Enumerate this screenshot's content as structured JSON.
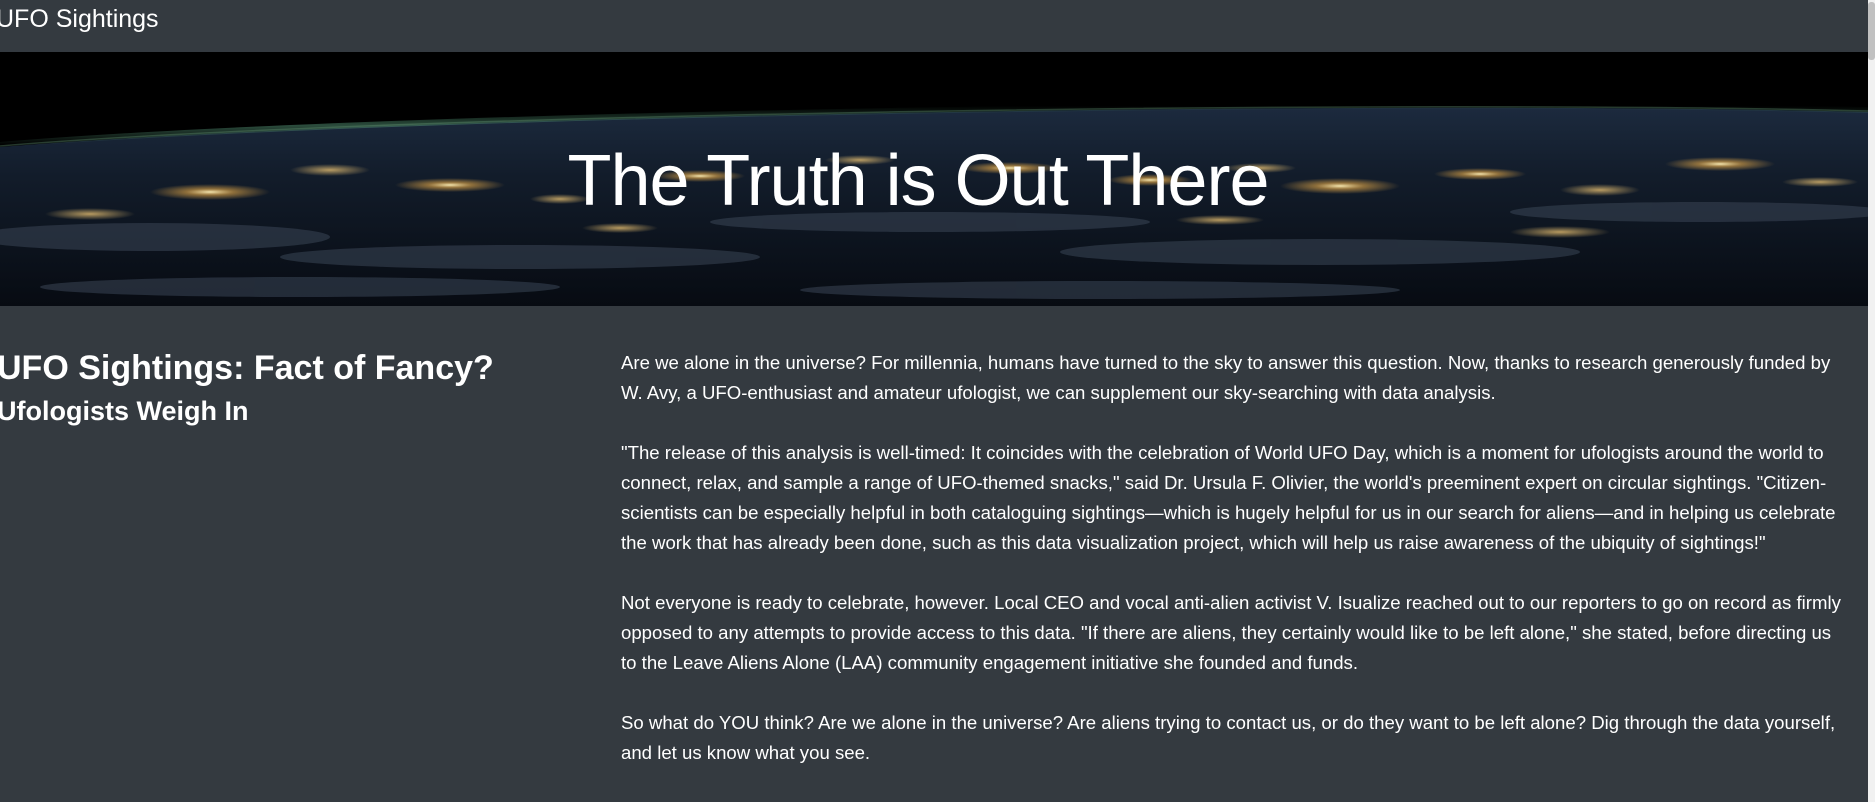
{
  "navbar": {
    "brand": "UFO Sightings"
  },
  "hero": {
    "title": "The Truth is Out There"
  },
  "main": {
    "headline": "UFO Sightings: Fact of Fancy?",
    "subheadline": "Ufologists Weigh In",
    "paragraphs": [
      "Are we alone in the universe? For millennia, humans have turned to the sky to answer this question. Now, thanks to research generously funded by W. Avy, a UFO-enthusiast and amateur ufologist, we can supplement our sky-searching with data analysis.",
      "\"The release of this analysis is well-timed: It coincides with the celebration of World UFO Day, which is a moment for ufologists around the world to connect, relax, and sample a range of UFO-themed snacks,\" said Dr. Ursula F. Olivier, the world's preeminent expert on circular sightings. \"Citizen-scientists can be especially helpful in both cataloguing sightings—which is hugely helpful for us in our search for aliens—and in helping us celebrate the work that has already been done, such as this data visualization project, which will help us raise awareness of the ubiquity of sightings!\"",
      "Not everyone is ready to celebrate, however. Local CEO and vocal anti-alien activist V. Isualize reached out to our reporters to go on record as firmly opposed to any attempts to provide access to this data. \"If there are aliens, they certainly would like to be left alone,\" she stated, before directing us to the Leave Aliens Alone (LAA) community engagement initiative she founded and funds.",
      "So what do YOU think? Are we alone in the universe? Are aliens trying to contact us, or do they want to be left alone? Dig through the data yourself, and let us know what you see."
    ]
  }
}
